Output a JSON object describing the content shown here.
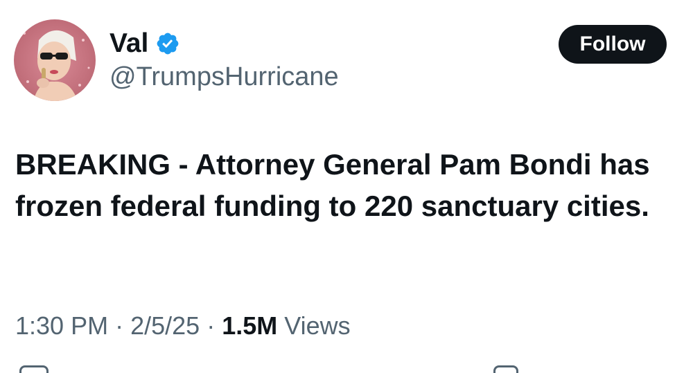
{
  "author": {
    "display_name": "Val",
    "handle": "@TrumpsHurricane",
    "avatar_icon": "profile-photo",
    "verified_icon": "verified-badge-icon",
    "verified_color": "#1d9bf0"
  },
  "follow_button": {
    "label": "Follow"
  },
  "tweet": {
    "text": "BREAKING - Attorney General Pam Bondi has frozen federal funding to 220 sanctuary cities."
  },
  "meta": {
    "time": "1:30 PM",
    "separator": "·",
    "date": "2/5/25",
    "views_count": "1.5M",
    "views_label": "Views"
  },
  "colors": {
    "text_primary": "#0f1419",
    "text_secondary": "#536471",
    "button_bg": "#0f1419",
    "button_text": "#ffffff"
  }
}
